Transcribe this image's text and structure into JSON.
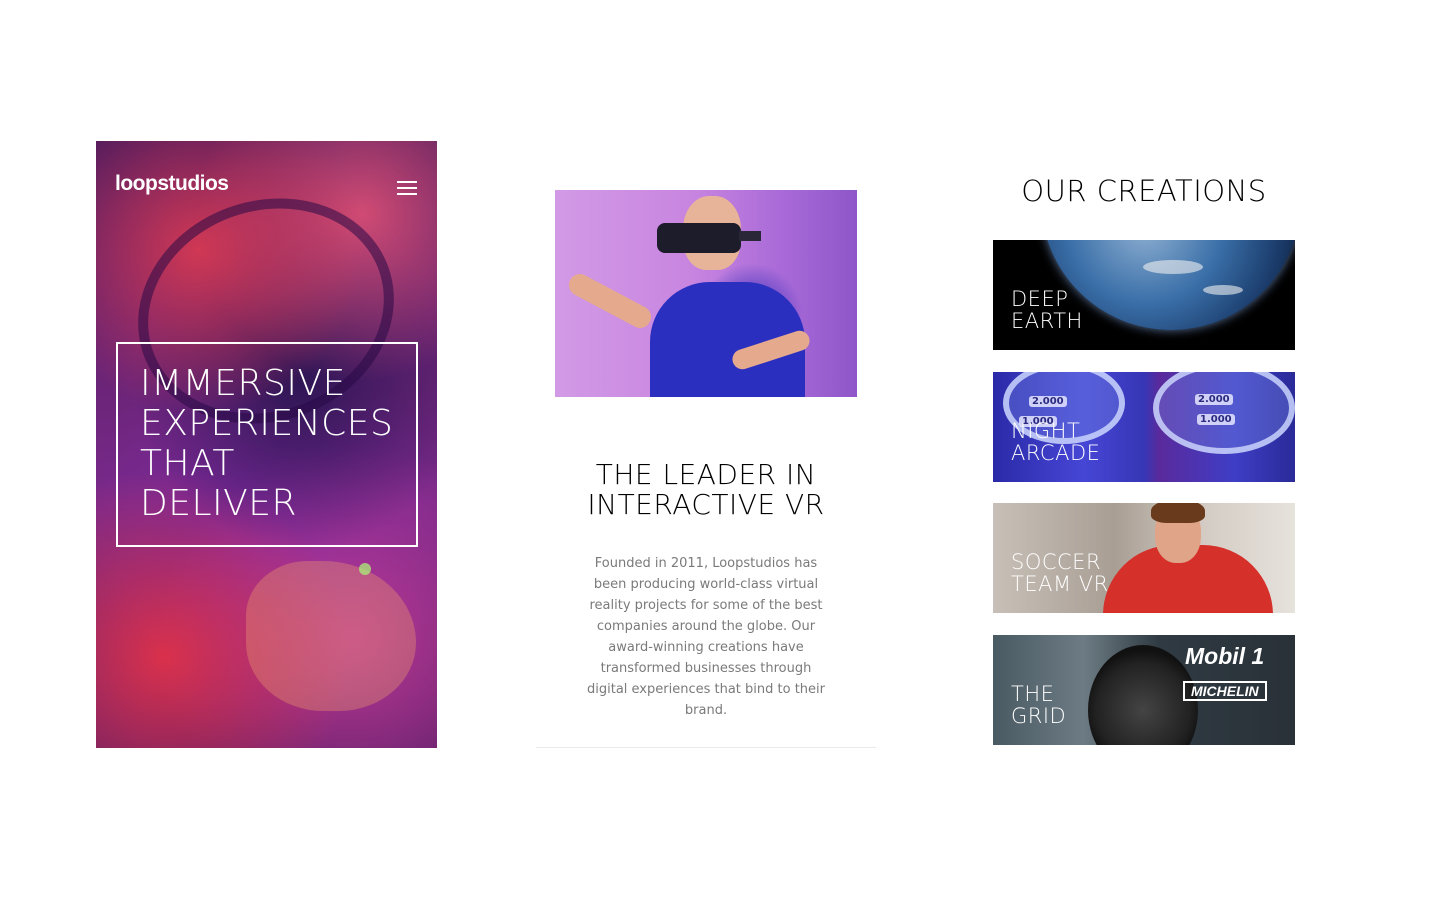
{
  "hero": {
    "logo": "loopstudios",
    "menu_icon": "hamburger-icon",
    "headline_lines": [
      "IMMERSIVE",
      "EXPERIENCES",
      "THAT",
      "DELIVER"
    ]
  },
  "about": {
    "image_alt": "man wearing VR headset",
    "title_lines": [
      "THE LEADER IN",
      "INTERACTIVE VR"
    ],
    "body": "Founded in 2011, Loopstudios has been producing world-class virtual reality projects for some of the best companies around the globe. Our award-winning creations have transformed businesses through digital experiences that bind to their brand."
  },
  "creations": {
    "title": "OUR CREATIONS",
    "cards": [
      {
        "title_lines": [
          "DEEP",
          "EARTH"
        ]
      },
      {
        "title_lines": [
          "NIGHT",
          "ARCADE"
        ]
      },
      {
        "title_lines": [
          "SOCCER",
          "TEAM VR"
        ]
      },
      {
        "title_lines": [
          "THE",
          "GRID"
        ]
      }
    ],
    "arcade_ring_labels": [
      "2.000",
      "2.000",
      "1.000",
      "1.000"
    ],
    "grid_sponsors": [
      "Mobil 1",
      "MICHELIN"
    ]
  },
  "colors": {
    "hero_overlay": "#6a2478",
    "about_image_bg": "#c885e0",
    "body_text": "#7a7a7a",
    "heading_text": "#000000"
  }
}
